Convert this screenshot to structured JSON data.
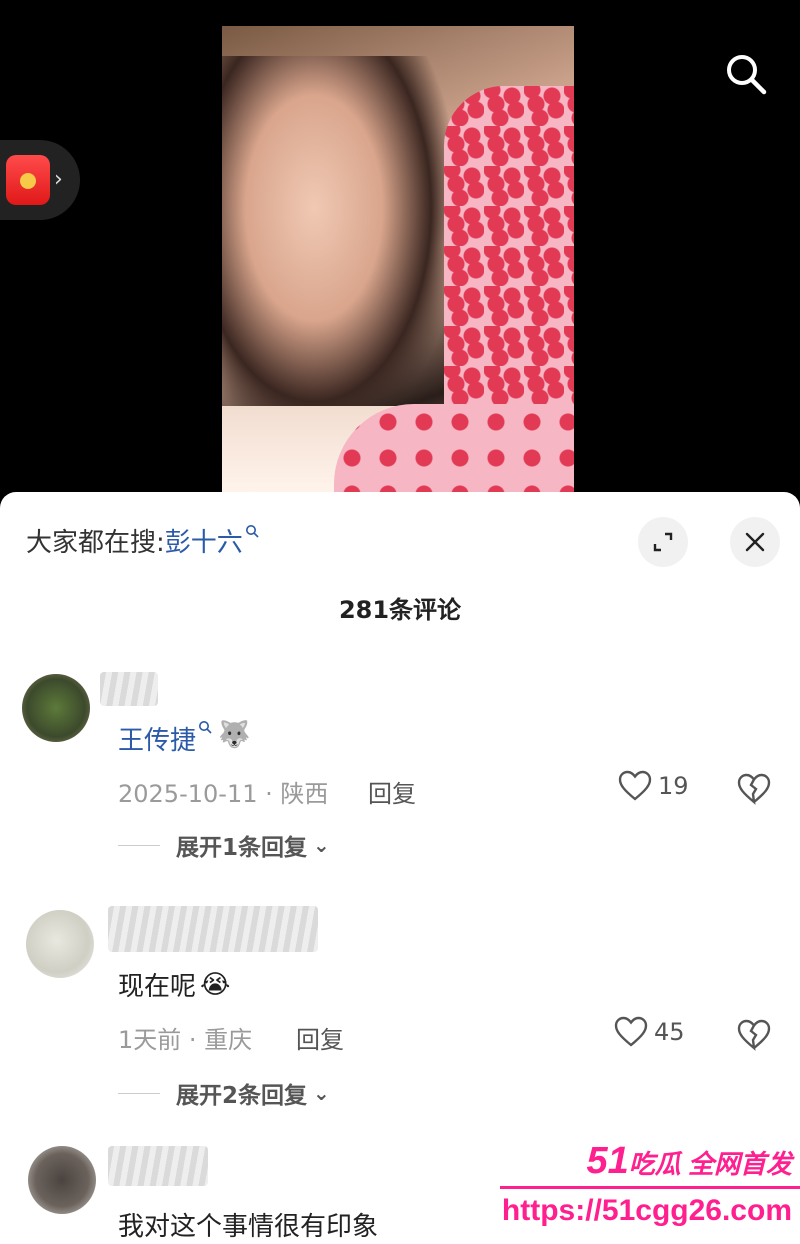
{
  "colors": {
    "link_blue": "#2b5aa8",
    "meta_gray": "#9a9a9a",
    "watermark_pink": "#ff1f8e",
    "sheet_bg": "#ffffff"
  },
  "top_bar": {
    "search_icon": "search-icon",
    "red_packet_icon": "red-packet-icon"
  },
  "sheet": {
    "trending_prefix": "大家都在搜:",
    "trending_term": "彭十六",
    "comment_count_title": "281条评论"
  },
  "comments": [
    {
      "username": "王传捷",
      "badge_emoji": "🐺",
      "meta": "2025-10-11 · 陕西",
      "reply_label": "回复",
      "likes": "19",
      "expand_label": "展开1条回复"
    },
    {
      "text": "现在呢",
      "emoji": "😭",
      "meta": "1天前 · 重庆",
      "reply_label": "回复",
      "likes": "45",
      "expand_label": "展开2条回复"
    },
    {
      "text": "我对这个事情很有印象"
    }
  ],
  "watermark": {
    "num": "51",
    "line1": "吃瓜 全网首发",
    "line2": "https://51cgg26.com"
  }
}
